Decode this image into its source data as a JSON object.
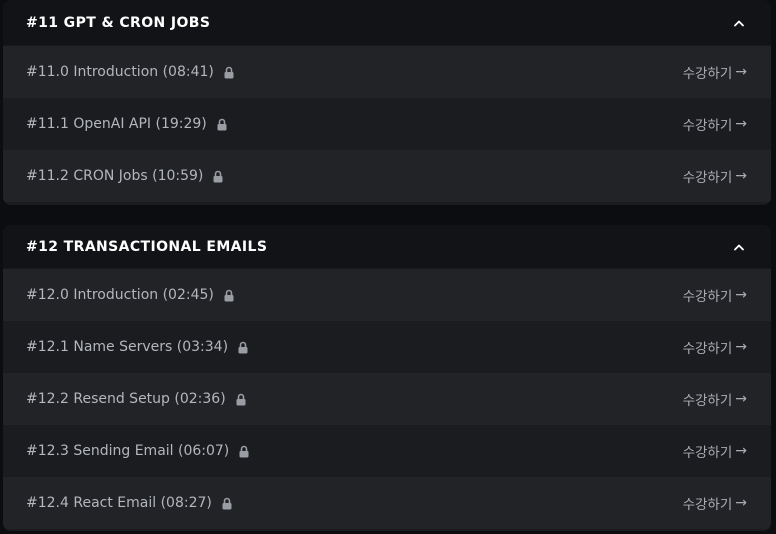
{
  "sections": [
    {
      "title": "#11 GPT & CRON JOBS",
      "lessons": [
        {
          "title": "#11.0 Introduction (08:41)",
          "cta": "수강하기",
          "arrow": "→"
        },
        {
          "title": "#11.1 OpenAI API (19:29)",
          "cta": "수강하기",
          "arrow": "→"
        },
        {
          "title": "#11.2 CRON Jobs (10:59)",
          "cta": "수강하기",
          "arrow": "→"
        }
      ]
    },
    {
      "title": "#12 TRANSACTIONAL EMAILS",
      "lessons": [
        {
          "title": "#12.0 Introduction (02:45)",
          "cta": "수강하기",
          "arrow": "→"
        },
        {
          "title": "#12.1 Name Servers (03:34)",
          "cta": "수강하기",
          "arrow": "→"
        },
        {
          "title": "#12.2 Resend Setup (02:36)",
          "cta": "수강하기",
          "arrow": "→"
        },
        {
          "title": "#12.3 Sending Email (06:07)",
          "cta": "수강하기",
          "arrow": "→"
        },
        {
          "title": "#12.4 React Email (08:27)",
          "cta": "수강하기",
          "arrow": "→"
        }
      ]
    }
  ],
  "colors": {
    "background": "#0c0d10",
    "header_bg": "#121317",
    "row_alt": "#222327",
    "row_base": "#1b1c20",
    "title_text": "#ffffff",
    "lesson_text": "#b3b6bd"
  },
  "icons": {
    "section_toggle": "chevron-up-icon",
    "lesson_status": "lock-icon"
  }
}
